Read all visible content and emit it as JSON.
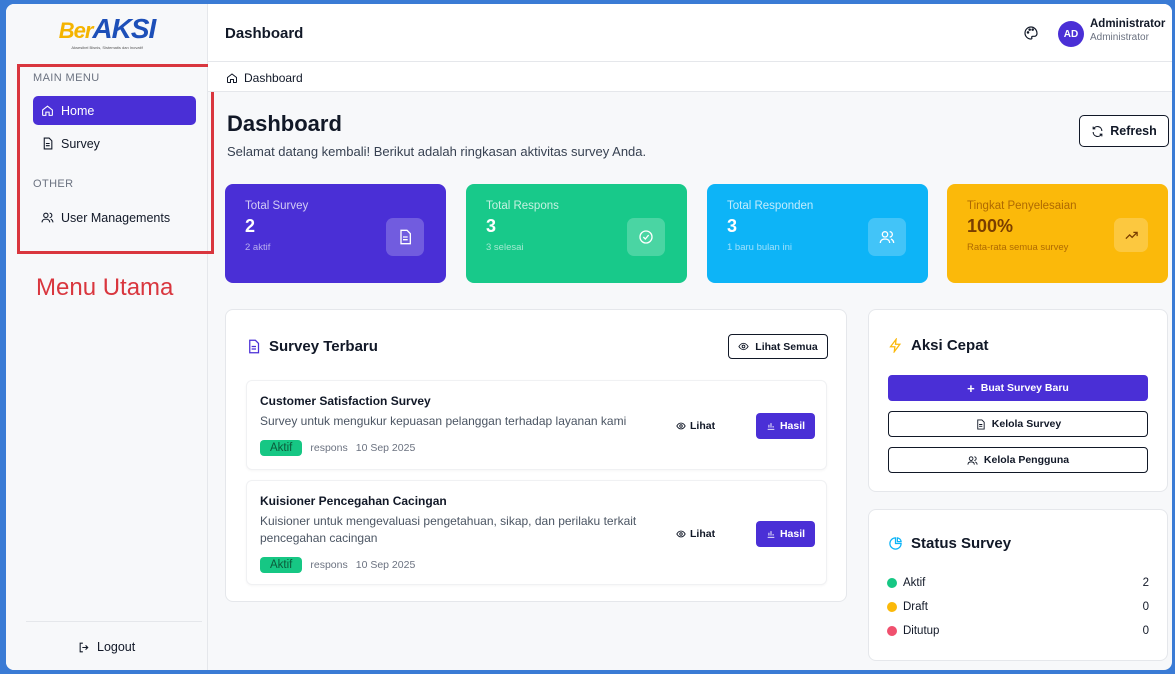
{
  "logo": {
    "text_prefix": "Ber",
    "text_main": "AKSI",
    "tagline": "Aksesibel Bisnis, Sistematis dan Inovatif"
  },
  "sidebar": {
    "main_menu_label": "MAIN MENU",
    "other_label": "OTHER",
    "items": [
      {
        "label": "Home",
        "icon": "home-icon",
        "active": true
      },
      {
        "label": "Survey",
        "icon": "document-icon",
        "active": false
      },
      {
        "label": "User Managements",
        "icon": "users-icon",
        "active": false
      }
    ],
    "logout_label": "Logout"
  },
  "annotation": "Menu Utama",
  "header": {
    "title": "Dashboard",
    "avatar_initials": "AD",
    "user_name": "Administrator",
    "user_role": "Administrator"
  },
  "breadcrumb": {
    "label": "Dashboard"
  },
  "page": {
    "title": "Dashboard",
    "subtitle": "Selamat datang kembali! Berikut adalah ringkasan aktivitas survey Anda.",
    "refresh_label": "Refresh"
  },
  "stats": [
    {
      "label": "Total Survey",
      "value": "2",
      "sub": "2 aktif",
      "color": "#4a2fd6",
      "icon": "document-icon"
    },
    {
      "label": "Total Respons",
      "value": "3",
      "sub": "3 selesai",
      "color": "#18c98a",
      "icon": "check-circle-icon"
    },
    {
      "label": "Total Responden",
      "value": "3",
      "sub": "1 baru bulan ini",
      "color": "#0db4f7",
      "icon": "users-icon"
    },
    {
      "label": "Tingkat Penyelesaian",
      "value": "100%",
      "sub": "Rata-rata semua survey",
      "color": "#fbb90a",
      "icon": "trending-up-icon"
    }
  ],
  "recent": {
    "title": "Survey Terbaru",
    "view_all_label": "Lihat Semua",
    "view_label": "Lihat",
    "result_label": "Hasil",
    "items": [
      {
        "title": "Customer Satisfaction Survey",
        "desc": "Survey untuk mengukur kepuasan pelanggan terhadap layanan kami",
        "status": "Aktif",
        "responses": "respons",
        "date": "10 Sep 2025"
      },
      {
        "title": "Kuisioner Pencegahan Cacingan",
        "desc": "Kuisioner untuk mengevaluasi pengetahuan, sikap, dan perilaku terkait pencegahan cacingan",
        "status": "Aktif",
        "responses": "respons",
        "date": "10 Sep 2025"
      }
    ]
  },
  "quick": {
    "title": "Aksi Cepat",
    "create_label": "Buat Survey Baru",
    "manage_survey_label": "Kelola Survey",
    "manage_users_label": "Kelola Pengguna"
  },
  "status": {
    "title": "Status Survey",
    "rows": [
      {
        "label": "Aktif",
        "count": "2",
        "color": "#16c784"
      },
      {
        "label": "Draft",
        "count": "0",
        "color": "#fbb90a"
      },
      {
        "label": "Ditutup",
        "count": "0",
        "color": "#f0506e"
      }
    ]
  }
}
